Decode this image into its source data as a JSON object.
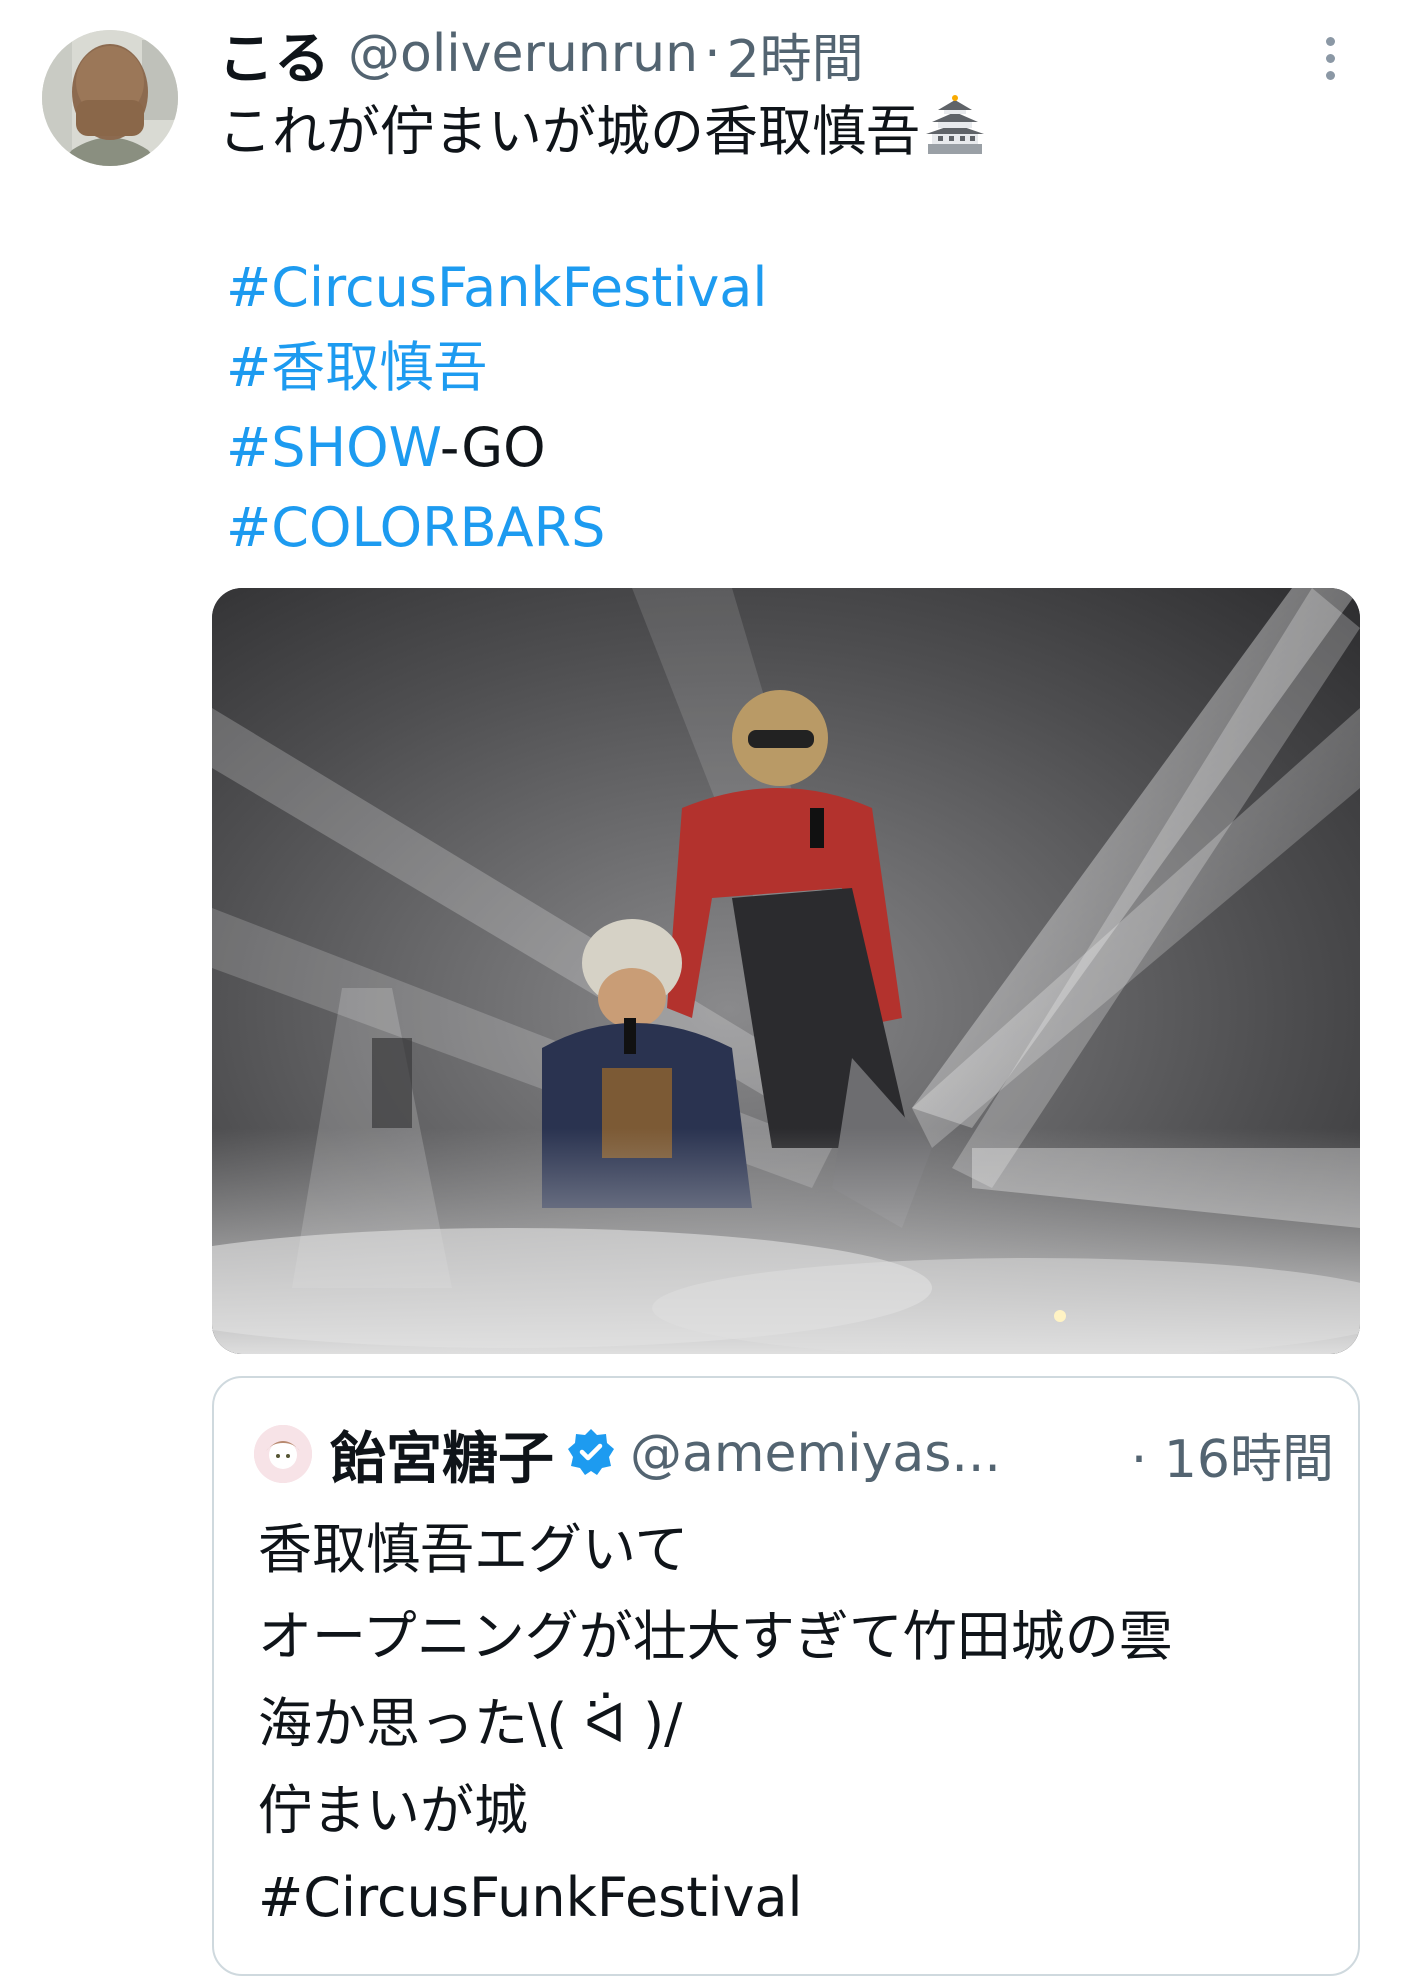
{
  "tweet": {
    "display_name": "こる",
    "handle": "@oliverunrun",
    "separator": "·",
    "time": "2時間",
    "text": "これが佇まいが城の香取慎吾",
    "text_emoji": "castle-icon",
    "hashtags": [
      {
        "tag": "#CircusFankFestival",
        "suffix": ""
      },
      {
        "tag": "#香取慎吾",
        "suffix": ""
      },
      {
        "tag": "#SHOW",
        "suffix": "-GO"
      },
      {
        "tag": "#COLORBARS",
        "suffix": ""
      }
    ],
    "media_description_icon": "stage-photo"
  },
  "quote": {
    "display_name": "飴宮糖子",
    "verified": true,
    "handle": "@amemiyas...",
    "time": "· 16時間",
    "lines": [
      "香取慎吾エグいて",
      "オープニングが壮大すぎて竹田城の雲",
      "海か思った\\( ᐛ )/",
      "佇まいが城",
      "#CircusFunkFestival"
    ]
  },
  "colors": {
    "link": "#1d9bf0",
    "text": "#0f1419",
    "muted": "#536471",
    "border": "#cfd9de",
    "verified": "#1d9bf0"
  }
}
